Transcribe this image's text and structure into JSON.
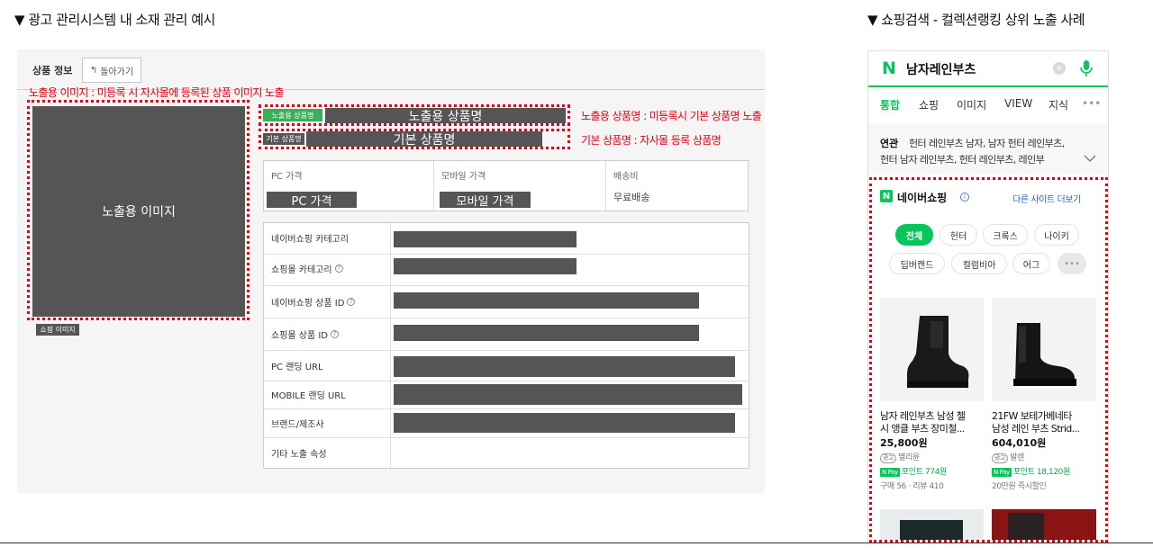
{
  "headings": {
    "left": "▼ 광고 관리시스템 내 소재 관리 예시",
    "right": "▼ 쇼핑검색 - 컬렉션랭킹 상위 노출 사례"
  },
  "admin": {
    "title": "상품 정보",
    "back_label": "돌아가기",
    "annotations": {
      "image": "노출용 이미지 : 미등록 시 자사몰에 등록된 상품 이미지 노출",
      "display_name": "노출용 상품명 : 미등록시 기본 상품명 노출",
      "base_name": "기본 상품명 : 자사몰 등록 상품명"
    },
    "image_placeholder": "노출용 이미지",
    "image_tag": "쇼핑 이미지",
    "display_name_tag": "노출용 상품명",
    "display_name_placeholder": "노출용 상품명",
    "base_name_tag": "기본 상품명",
    "base_name_placeholder": "기본 상품명",
    "price": {
      "pc_label": "PC 가격",
      "pc_value": "PC 가격",
      "mobile_label": "모바일 가격",
      "mobile_value": "모바일 가격",
      "shipping_label": "배송비",
      "shipping_value": "무료배송"
    },
    "rows": [
      {
        "label": "네이버쇼핑 카테고리"
      },
      {
        "label": "쇼핑몰 카테고리"
      },
      {
        "label": "네이버쇼핑 상품 ID"
      },
      {
        "label": "쇼핑몰 상품 ID"
      },
      {
        "label": "PC 랜딩 URL"
      },
      {
        "label": "MOBILE 랜딩 URL"
      },
      {
        "label": "브랜드/제조사"
      },
      {
        "label": "기타 노출 속성"
      }
    ]
  },
  "mobile": {
    "logo": "N",
    "query": "남자레인부츠",
    "tabs": [
      "통합",
      "쇼핑",
      "이미지",
      "VIEW",
      "지식",
      "•••"
    ],
    "related_label": "연관",
    "related_line1": "헌터 레인부츠 남자, 남자 헌터 레인부츠,",
    "related_line2": "헌터 남자 레인부츠, 헌터 레인부츠, 레인부",
    "shopping_title": "네이버쇼핑",
    "other_sites": "다른 사이트 더보기",
    "chips": [
      "전체",
      "헌터",
      "크록스",
      "나이키",
      "딥버캔드",
      "컬럼비아",
      "어그",
      "•••"
    ],
    "products": [
      {
        "title1": "남자 레인부츠 남성 첼",
        "title2": "시 앵클 부츠 장미철...",
        "price": "25,800원",
        "ad": "광고",
        "seller": "멸리윤",
        "points": "포인트 774원",
        "meta": "구매 56 · 리뷰 410"
      },
      {
        "title1": "21FW 보테가베네타",
        "title2": "남성 레인 부츠 Strid...",
        "price": "604,010원",
        "ad": "광고",
        "seller": "발렌",
        "points": "포인트 18,120원",
        "meta": "20만원 즉시할인"
      }
    ],
    "npay_label": "N Pay"
  },
  "colors": {
    "accent_red": "#e60012",
    "naver_green": "#03c75a",
    "placeholder_gray": "#555555"
  }
}
